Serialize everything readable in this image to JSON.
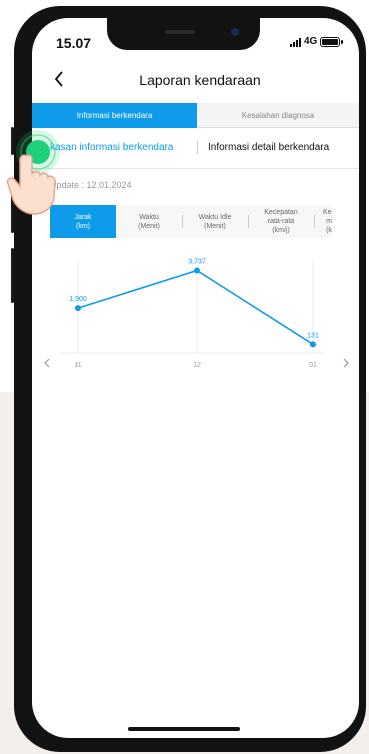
{
  "status_bar": {
    "time": "15.07",
    "network": "4G"
  },
  "header": {
    "back_icon": "chevron-left-icon",
    "title": "Laporan kendaraan"
  },
  "top_tabs": [
    {
      "label": "Informasi berkendara",
      "active": true
    },
    {
      "label": "Kesalahan diagnosa",
      "active": false
    }
  ],
  "sub_tabs": [
    {
      "label": "kasan informasi berkendara",
      "active": true
    },
    {
      "label": "Informasi detail berkendara",
      "active": false
    }
  ],
  "update_text": "Update : 12.01,2024",
  "metric_tabs": [
    {
      "label": "Jarak\n(km)",
      "active": true
    },
    {
      "label": "Waktu\n(Menit)",
      "active": false
    },
    {
      "label": "Waktu Idle\n(Menit)",
      "active": false
    },
    {
      "label": "Kecepatan\nrata-rata\n(km/j)",
      "active": false
    },
    {
      "label": "Kec\nm\n(k",
      "active": false
    }
  ],
  "chart_nav": {
    "prev_icon": "chevron-left-icon",
    "next_icon": "chevron-right-icon"
  },
  "chart_data": {
    "type": "line",
    "categories": [
      "11",
      "12",
      "01"
    ],
    "values": [
      1900,
      3737,
      131
    ],
    "value_labels": [
      "1,900",
      "3,737",
      "131"
    ],
    "title": "",
    "xlabel": "",
    "ylabel": "",
    "ylim": [
      0,
      4200
    ],
    "grid": "vertical",
    "line_color": "#0d9bea"
  },
  "colors": {
    "accent": "#0d9bea",
    "touch_indicator": "#1fd07a"
  }
}
